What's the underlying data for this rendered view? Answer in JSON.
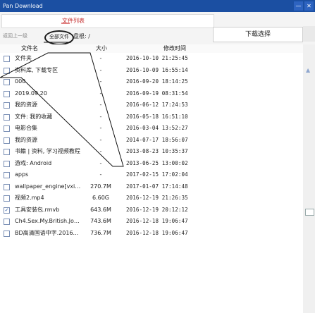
{
  "app": {
    "title": "Pan Download"
  },
  "window": {
    "min": "—",
    "close": "✕"
  },
  "tab": {
    "label": "文件列表"
  },
  "toolbar": {
    "download": "下载选择"
  },
  "path": {
    "back": "返回上一级",
    "bubble": "全部文件",
    "rest": "盘根: /"
  },
  "columns": {
    "name": "文件名",
    "size": "大小",
    "date": "修改时间"
  },
  "files": [
    {
      "name": "文件夹",
      "size": "-",
      "date": "2016-10-10 21:25:45",
      "checked": false
    },
    {
      "name": "资料库, 下载专区",
      "size": "-",
      "date": "2016-10-09 16:55:14",
      "checked": false
    },
    {
      "name": "000",
      "size": "-",
      "date": "2016-09-20 18:14:25",
      "checked": false
    },
    {
      "name": "2019.09.20",
      "size": "-",
      "date": "2016-09-19 08:31:54",
      "checked": false
    },
    {
      "name": "我的资源",
      "size": "-",
      "date": "2016-06-12 17:24:53",
      "checked": false
    },
    {
      "name": "文件: 我的收藏",
      "size": "-",
      "date": "2016-05-18 16:51:10",
      "checked": false
    },
    {
      "name": "电影合集",
      "size": "-",
      "date": "2016-03-04 13:52:27",
      "checked": false
    },
    {
      "name": "我的资源",
      "size": "-",
      "date": "2014-07-17 18:56:07",
      "checked": false
    },
    {
      "name": "书籍 | 资料, 学习视频教程",
      "size": "-",
      "date": "2013-08-23 10:35:37",
      "checked": false
    },
    {
      "name": "游戏: Android",
      "size": "-",
      "date": "2013-06-25 13:00:02",
      "checked": false
    },
    {
      "name": "apps",
      "size": "-",
      "date": "2017-02-15 17:02:04",
      "checked": false
    },
    {
      "name": "wallpaper_engine[vxia.n...",
      "size": "270.7M",
      "date": "2017-01-07 17:14:48",
      "checked": false
    },
    {
      "name": "视频2.mp4",
      "size": "6.60G",
      "date": "2016-12-19 21:26:35",
      "checked": false
    },
    {
      "name": "工具安装包.rmvb",
      "size": "643.6M",
      "date": "2016-12-19 20:12:12",
      "checked": true
    },
    {
      "name": "Ch4.Sex.My.British.Job...",
      "size": "743.6M",
      "date": "2016-12-18 19:06:47",
      "checked": false
    },
    {
      "name": "BD高清国语中字.2016...",
      "size": "736.7M",
      "date": "2016-12-18 19:06:47",
      "checked": false
    }
  ],
  "scroll": {
    "up": "▲"
  }
}
